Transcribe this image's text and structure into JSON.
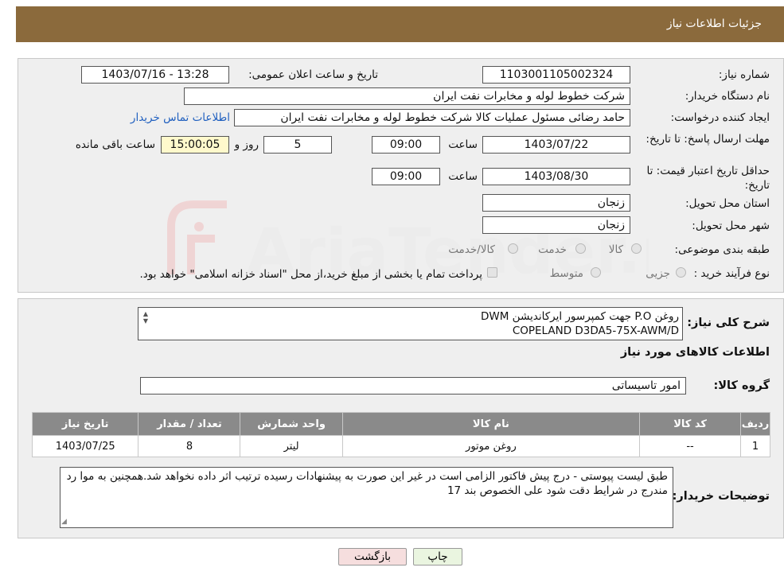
{
  "header": {
    "title": "جزئیات اطلاعات نیاز"
  },
  "form": {
    "need_number": {
      "label": "شماره نیاز:",
      "value": "1103001105002324"
    },
    "announce_datetime": {
      "label": "تاریخ و ساعت اعلان عمومی:",
      "value": "1403/07/16 - 13:28"
    },
    "buyer_org": {
      "label": "نام دستگاه خریدار:",
      "value": "شرکت خطوط لوله و مخابرات نفت ایران"
    },
    "requester": {
      "label": "ایجاد کننده درخواست:",
      "value": "حامد  رضائی  مسئول عملیات کالا  شرکت خطوط لوله و مخابرات نفت ایران"
    },
    "buyer_contact_link": "اطلاعات تماس خریدار",
    "response_deadline": {
      "label": "مهلت ارسال پاسخ: تا تاریخ:",
      "date": "1403/07/22",
      "time_label": "ساعت",
      "time": "09:00",
      "days": "5",
      "days_label": "روز و",
      "remaining": "15:00:05",
      "remaining_label": "ساعت باقی مانده"
    },
    "price_validity": {
      "label": "حداقل تاریخ اعتبار قیمت: تا تاریخ:",
      "date": "1403/08/30",
      "time_label": "ساعت",
      "time": "09:00"
    },
    "delivery_province": {
      "label": "استان محل تحویل:",
      "value": "زنجان"
    },
    "delivery_city": {
      "label": "شهر محل تحویل:",
      "value": "زنجان"
    },
    "category": {
      "label": "طبقه بندی موضوعی:",
      "options": [
        "کالا",
        "خدمت",
        "کالا/خدمت"
      ]
    },
    "purchase_process": {
      "label": "نوع فرآیند خرید :",
      "options": [
        "جزیی",
        "متوسط"
      ],
      "note": "پرداخت تمام یا بخشی از مبلغ خرید،از محل \"اسناد خزانه اسلامی\" خواهد بود."
    }
  },
  "description": {
    "label": "شرح کلی نیاز:",
    "line1": "روغن P.O جهت کمپرسور ایرکاندیشن DWM",
    "line2": "COPELAND D3DA5-75X-AWM/D"
  },
  "items_section": {
    "title": "اطلاعات کالاهای مورد نیاز",
    "group_label": "گروه کالا:",
    "group_value": "امور تاسیساتی",
    "columns": [
      "ردیف",
      "کد کالا",
      "نام کالا",
      "واحد شمارش",
      "تعداد / مقدار",
      "تاریخ نیاز"
    ],
    "rows": [
      {
        "row": "1",
        "code": "--",
        "name": "روغن موتور",
        "unit": "لیتر",
        "qty": "8",
        "date": "1403/07/25"
      }
    ]
  },
  "buyer_notes": {
    "label": "توضیحات خریدار:",
    "text": "طبق لیست پیوستی - درج پیش فاکتور الزامی است در غیر این صورت به پیشنهادات رسیده ترتیب اثر داده نخواهد شد.همچنین به موا رد مندرج در شرایط دقت شود علی الخصوص بند 17"
  },
  "buttons": {
    "print": "چاپ",
    "back": "بازگشت"
  },
  "watermark": {
    "text": "AriaTender.neT"
  },
  "colors": {
    "header": "#8b6a3c",
    "link": "#1f5fbf",
    "table_header": "#8a8a8a",
    "back_button": "#f6dede"
  }
}
